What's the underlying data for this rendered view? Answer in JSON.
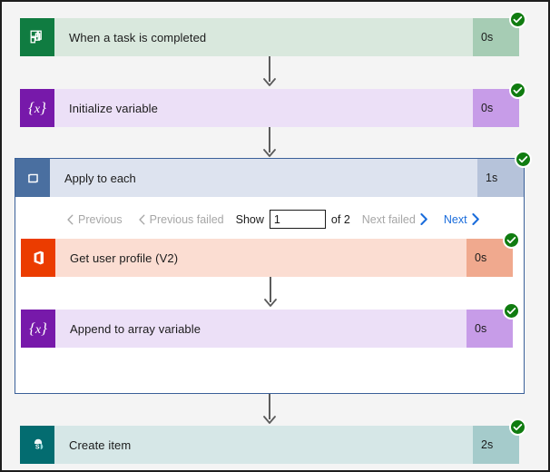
{
  "canvas": {
    "background_color": "#f4f4f4",
    "border_color": "#1d1d1d"
  },
  "status": {
    "succeeded_label": "Succeeded",
    "succeeded_color": "#107c10",
    "check_glyph": "check-icon"
  },
  "steps": [
    {
      "id": "when-a-task-is-completed",
      "title": "When a task is completed",
      "duration": "0s",
      "icon": "planner-icon",
      "icon_bg": "#107c41",
      "body_color": "#d9e8dd",
      "duration_color": "#a6ccb4",
      "status": "succeeded"
    },
    {
      "id": "initialize-variable",
      "title": "Initialize variable",
      "duration": "0s",
      "icon": "variables-icon",
      "icon_bg": "#7719aa",
      "body_color": "#ece0f7",
      "duration_color": "#c79ce8",
      "status": "succeeded"
    }
  ],
  "loop": {
    "title": "Apply to each",
    "duration": "1s",
    "icon": "loop-icon",
    "icon_bg": "#4a6fa0",
    "header_color": "#dde3ef",
    "duration_color": "#b6c3da",
    "border_color": "#3a6099",
    "status": "succeeded",
    "pager": {
      "previous_label": "Previous",
      "previous_failed_label": "Previous failed",
      "show_label": "Show",
      "page_value": "1",
      "page_placeholder": "",
      "of_label": "of 2",
      "next_failed_label": "Next failed",
      "next_label": "Next",
      "disabled_color": "#a6a6a6",
      "link_color": "#1a6cdb"
    },
    "children": [
      {
        "id": "get-user-profile-v2",
        "title": "Get user profile (V2)",
        "duration": "0s",
        "icon": "office365-icon",
        "icon_bg": "#eb3c00",
        "body_color": "#fbddd2",
        "duration_color": "#f0a98e",
        "status": "succeeded"
      },
      {
        "id": "append-to-array-variable",
        "title": "Append to array variable",
        "duration": "0s",
        "icon": "variables-icon",
        "icon_bg": "#7719aa",
        "body_color": "#ece0f7",
        "duration_color": "#c79ce8",
        "status": "succeeded"
      }
    ]
  },
  "final_step": {
    "id": "create-item",
    "title": "Create item",
    "duration": "2s",
    "icon": "sharepoint-icon",
    "icon_bg": "#036c70",
    "body_color": "#d6e7e7",
    "duration_color": "#a5cbcb",
    "status": "succeeded"
  }
}
